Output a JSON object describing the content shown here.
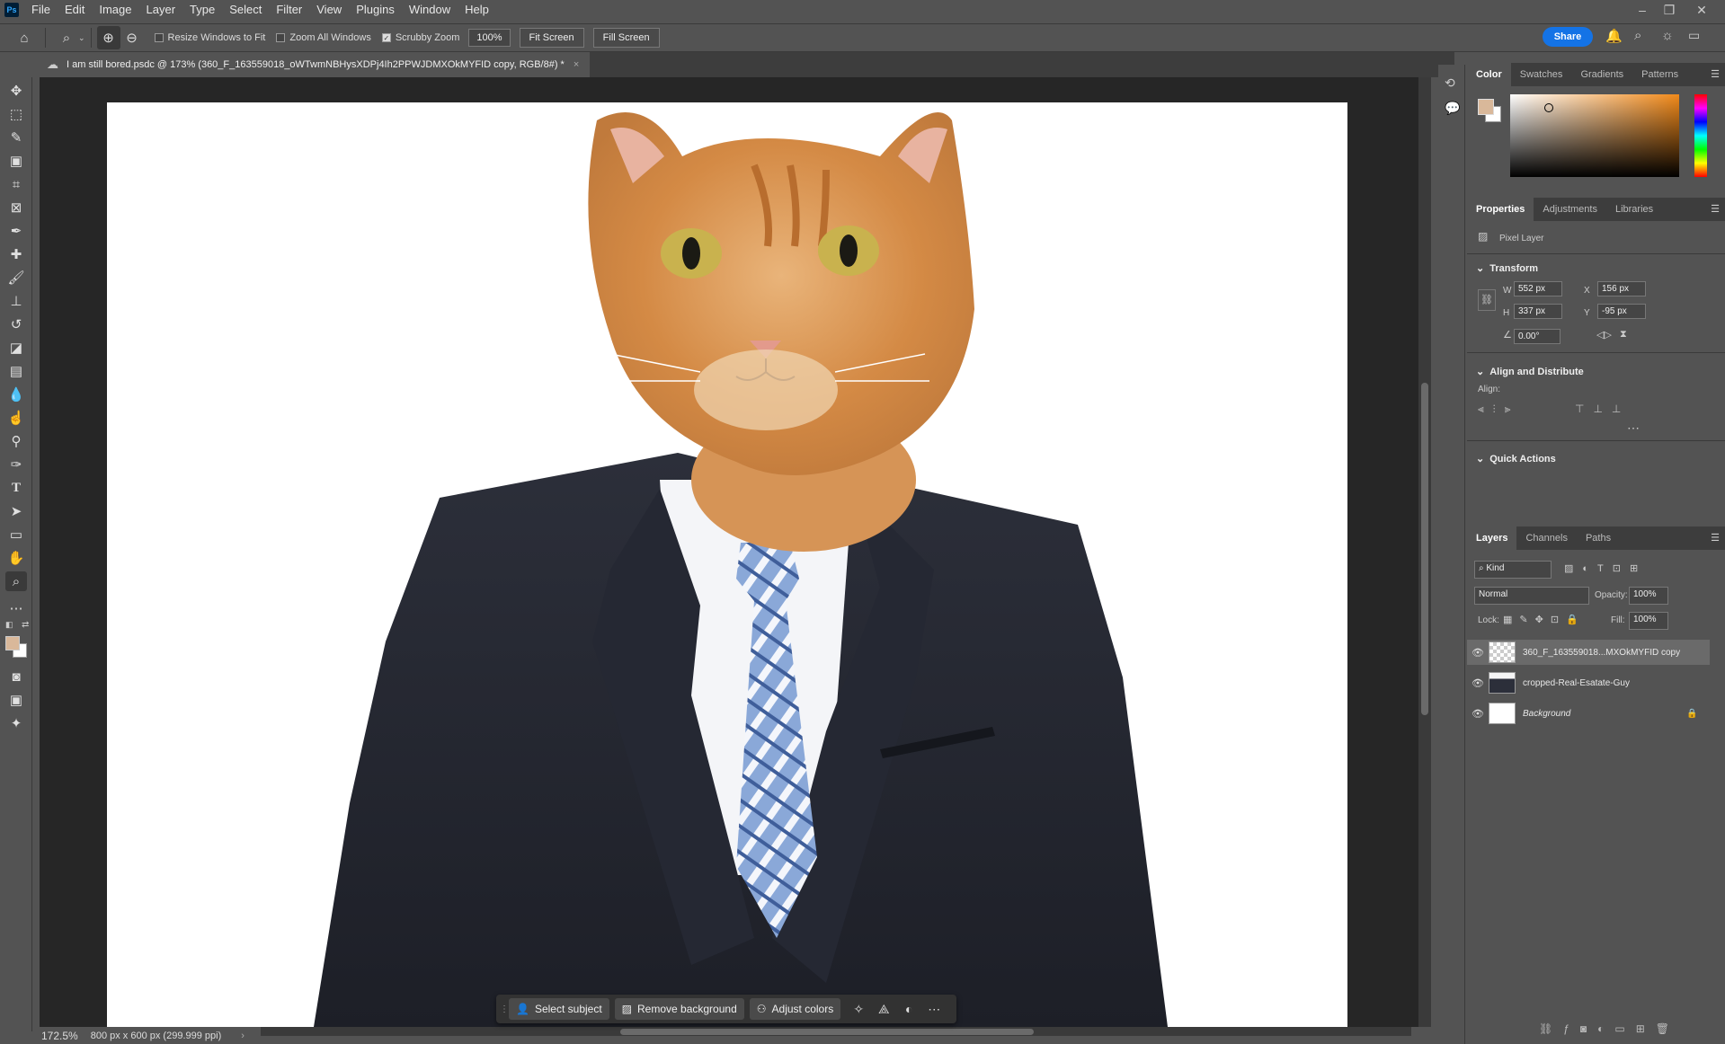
{
  "menu": [
    "File",
    "Edit",
    "Image",
    "Layer",
    "Type",
    "Select",
    "Filter",
    "View",
    "Plugins",
    "Window",
    "Help"
  ],
  "app_logo": "Ps",
  "options": {
    "resize_windows": "Resize Windows to Fit",
    "zoom_all": "Zoom All Windows",
    "scrubby_zoom": "Scrubby Zoom",
    "zoom_value": "100%",
    "fit_screen": "Fit Screen",
    "fill_screen": "Fill Screen",
    "share": "Share"
  },
  "document_tab": "I am still bored.psdc @ 173% (360_F_163559018_oWTwmNBHysXDPj4Ih2PPWJDMXOkMYFID copy, RGB/8#) *",
  "taskbar": {
    "select_subject": "Select subject",
    "remove_background": "Remove background",
    "adjust_colors": "Adjust colors"
  },
  "status": {
    "zoom": "172.5%",
    "doc_info": "800 px x 600 px (299.999 ppi)"
  },
  "color_panel": {
    "tabs": [
      "Color",
      "Swatches",
      "Gradients",
      "Patterns"
    ],
    "foreground": "#d9b89a",
    "background": "#ffffff"
  },
  "properties_panel": {
    "tabs": [
      "Properties",
      "Adjustments",
      "Libraries"
    ],
    "layer_type": "Pixel Layer",
    "transform_heading": "Transform",
    "w_label": "W",
    "w_value": "552 px",
    "h_label": "H",
    "h_value": "337 px",
    "x_label": "X",
    "x_value": "156 px",
    "y_label": "Y",
    "y_value": "-95 px",
    "angle_value": "0.00°",
    "align_heading": "Align and Distribute",
    "align_label": "Align:",
    "quick_actions_heading": "Quick Actions"
  },
  "layers_panel": {
    "tabs": [
      "Layers",
      "Channels",
      "Paths"
    ],
    "kind": "Kind",
    "blend_mode": "Normal",
    "opacity_label": "Opacity:",
    "opacity_value": "100%",
    "lock_label": "Lock:",
    "fill_label": "Fill:",
    "fill_value": "100%",
    "layers": [
      {
        "name": "360_F_163559018...MXOkMYFID copy",
        "selected": true
      },
      {
        "name": "cropped-Real-Esatate-Guy",
        "selected": false
      },
      {
        "name": "Background",
        "selected": false,
        "locked": true
      }
    ]
  }
}
